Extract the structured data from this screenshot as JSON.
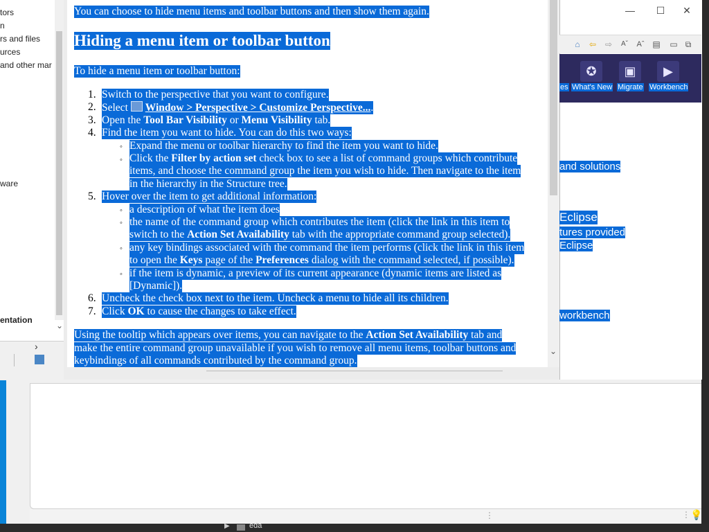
{
  "nav": {
    "items": [
      "tors",
      "n",
      "rs and files",
      "urces",
      "and other mar",
      "ware",
      "entation"
    ]
  },
  "doc": {
    "intro": "You can choose to hide menu items and toolbar buttons and then show them again.",
    "heading": "Hiding a menu item or toolbar button",
    "lead": "To hide a menu item or toolbar button:",
    "steps": {
      "s1": "Switch to the perspective that you want to configure.",
      "s2_pre": "Select ",
      "s2_link": "Window > Perspective > Customize Perspective...",
      "s2_post": ".",
      "s3_a": "Open the ",
      "s3_b": "Tool Bar Visibility",
      "s3_c": " or ",
      "s3_d": "Menu Visibility",
      "s3_e": " tab.",
      "s4": "Find the item you want to hide. You can do this two ways:",
      "s4_b1": "Expand the menu or toolbar hierarchy to find the item you want to hide.",
      "s4_b2_l1a": "Click the ",
      "s4_b2_l1b": "Filter by action set",
      "s4_b2_l1c": " check box to see a list of command groups which contribute",
      "s4_b2_l2": "items, and choose the command group the item you wish to hide. Then navigate to the item",
      "s4_b2_l3": "in the hierarchy in the Structure tree.",
      "s5": "Hover over the item to get additional information:",
      "s5_b1": "a description of what the item does",
      "s5_b2_l1": "the name of the command group which contributes the item (click the link in this item to",
      "s5_b2_l2a": "switch to the ",
      "s5_b2_l2b": "Action Set Availability",
      "s5_b2_l2c": " tab with the appropriate command group selected).",
      "s5_b3_l1": "any key bindings associated with the command the item performs (click the link in this item",
      "s5_b3_l2a": "to open the ",
      "s5_b3_l2b": "Keys",
      "s5_b3_l2c": " page of the ",
      "s5_b3_l2d": "Preferences",
      "s5_b3_l2e": " dialog with the command selected, if possible).",
      "s5_b4_l1": "if the item is dynamic, a preview of its current appearance (dynamic items are listed as",
      "s5_b4_l2": "[Dynamic]).",
      "s6": "Uncheck the check box next to the item. Uncheck a menu to hide all its children.",
      "s7_a": "Click ",
      "s7_b": "OK",
      "s7_c": " to cause the changes to take effect."
    },
    "numbers": [
      "1.",
      "2.",
      "3.",
      "4.",
      "5.",
      "6.",
      "7."
    ],
    "tail_l1a": "Using the tooltip which appears over items, you can navigate to the ",
    "tail_l1b": "Action Set Availability",
    "tail_l1c": " tab and",
    "tail_l2": "make the entire command group unavailable if you wish to remove all menu items, toolbar buttons and",
    "tail_l3": "keybindings of all commands contributed by the command group."
  },
  "welcome": {
    "tabs": [
      "es",
      "What's New",
      "Migrate",
      "Workbench"
    ],
    "lines": [
      "and solutions",
      "Eclipse",
      "tures provided",
      "Eclipse",
      "workbench"
    ]
  },
  "window": {
    "minimize": "—",
    "maximize": "☐",
    "close": "✕"
  },
  "taskbar": {
    "item": "eda"
  },
  "colors": {
    "selection": "#0a6ad8",
    "banner": "#2d2a5e"
  }
}
